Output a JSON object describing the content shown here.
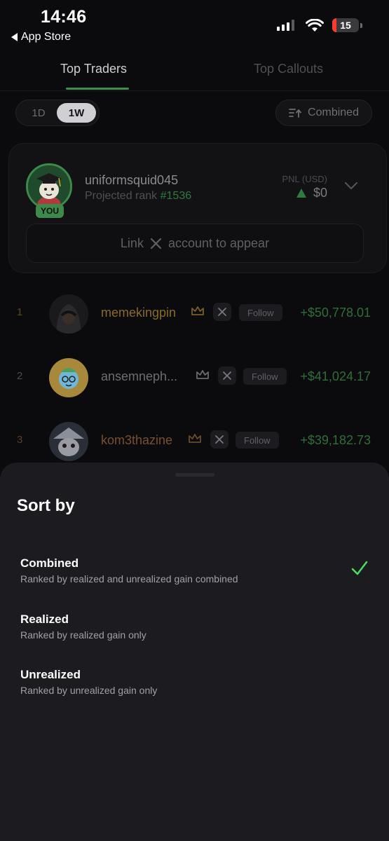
{
  "status_bar": {
    "time": "14:46",
    "back_label": "App Store",
    "battery": "15"
  },
  "tabs": [
    {
      "label": "Top Traders",
      "active": true
    },
    {
      "label": "Top Callouts",
      "active": false
    }
  ],
  "period": {
    "options": [
      "1D",
      "1W"
    ],
    "selected": "1W"
  },
  "sort_button": {
    "label": "Combined"
  },
  "user_card": {
    "username": "uniformsquid045",
    "rank_prefix": "Projected rank",
    "rank": "#1536",
    "badge": "YOU",
    "pnl_label": "PNL (USD)",
    "pnl_value": "$0",
    "link_prefix": "Link",
    "link_suffix": "account to appear"
  },
  "traders": [
    {
      "rank": "1",
      "name": "memekingpin",
      "pnl": "+$50,778.01",
      "follow": "Follow",
      "name_color": "#8a6a26"
    },
    {
      "rank": "2",
      "name": "ansemneph...",
      "pnl": "+$41,024.17",
      "follow": "Follow",
      "name_color": "#6d6d72"
    },
    {
      "rank": "3",
      "name": "kom3thazine",
      "pnl": "+$39,182.73",
      "follow": "Follow",
      "name_color": "#7a4e30"
    }
  ],
  "sort_sheet": {
    "title": "Sort by",
    "options": [
      {
        "title": "Combined",
        "description": "Ranked by realized and unrealized gain combined",
        "selected": true
      },
      {
        "title": "Realized",
        "description": "Ranked by realized gain only",
        "selected": false
      },
      {
        "title": "Unrealized",
        "description": "Ranked by unrealized gain only",
        "selected": false
      }
    ]
  },
  "colors": {
    "accent_green": "#3d8a4b",
    "check_green": "#4cd964",
    "sheet_bg": "#1b1b20"
  }
}
